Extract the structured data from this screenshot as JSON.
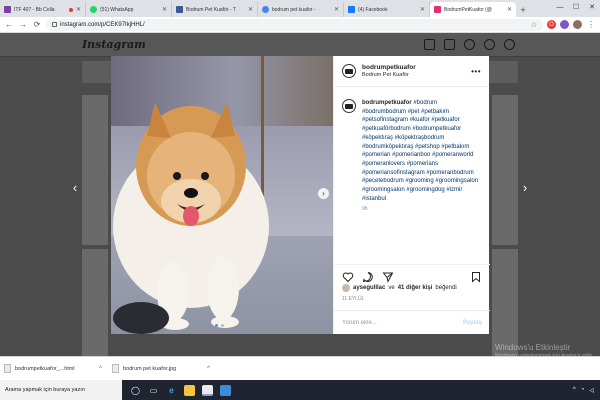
{
  "browser": {
    "tabs": [
      {
        "title": "ITF 407 - Bb Colla",
        "favicon_color": "#7b3fa0",
        "recording": true
      },
      {
        "title": "(51) WhatsApp",
        "favicon_color": "#25d366"
      },
      {
        "title": "Bodrum Pet Kuaför - T",
        "favicon_color": "#3b5998"
      },
      {
        "title": "bodrum pet kuafor -",
        "favicon_color": "#4285f4"
      },
      {
        "title": "(4) Facebook",
        "favicon_color": "#1877f2"
      },
      {
        "title": "BodrumPetKuafor (@",
        "favicon_color": "#e1306c",
        "active": true
      }
    ],
    "new_tab": "+",
    "window_controls": [
      "—",
      "☐",
      "✕"
    ],
    "url": "instagram.com/p/CEK97IkjHHL/",
    "nav": [
      "←",
      "→",
      "⟳"
    ]
  },
  "instagram": {
    "logo": "Instagram",
    "post": {
      "username": "bodrumpetkuafor",
      "location": "Bodrum Pet Kuaför",
      "more": "•••",
      "caption_user": "bodrumpetkuafor",
      "caption_tags": "#bodrum #bodrumbodrum #pet #petbakım #petsofinstagram #kuafor #petkuafor #petkuaförbodrum #bodrumpetkuafor #köpektıraş #köpektraşbodrum #bodrumköpektıraş #petshop #petbakım #pomerian #pomerianboo #pomeranworld #pomeranlovers #pomerians #pomeriansofinstagram #pomeranbodrum #pecetebodrum #grooming #groomingsalon #groomingsalon #groomingdog #izmir #istanbul",
      "caption_time": "9h",
      "likes_user": "aysegulllac",
      "likes_text": "ve",
      "likes_count": "41 diğer kişi",
      "likes_suffix": "beğendi",
      "post_time": "11 EYLÜL",
      "comment_placeholder": "Yorum ekle...",
      "comment_post": "Paylaş",
      "slide_next": "›",
      "slide_index": 1,
      "slide_count": 2
    }
  },
  "watermark": {
    "line1": "Windows'u Etkinleştir",
    "line2": "Windows'u etkinleştirmek için Ayarlar'a gidin."
  },
  "downloads": [
    {
      "name": "bodrumpetkuafor_...html"
    },
    {
      "name": "bodrum pet kuafor.jpg"
    }
  ],
  "taskbar": {
    "search_placeholder": "Arama yapmak için buraya yazın",
    "icons": [
      "start-icon",
      "cortana-icon",
      "task-view-icon",
      "edge-icon",
      "file-explorer-icon",
      "notepad-icon",
      "store-icon"
    ]
  }
}
